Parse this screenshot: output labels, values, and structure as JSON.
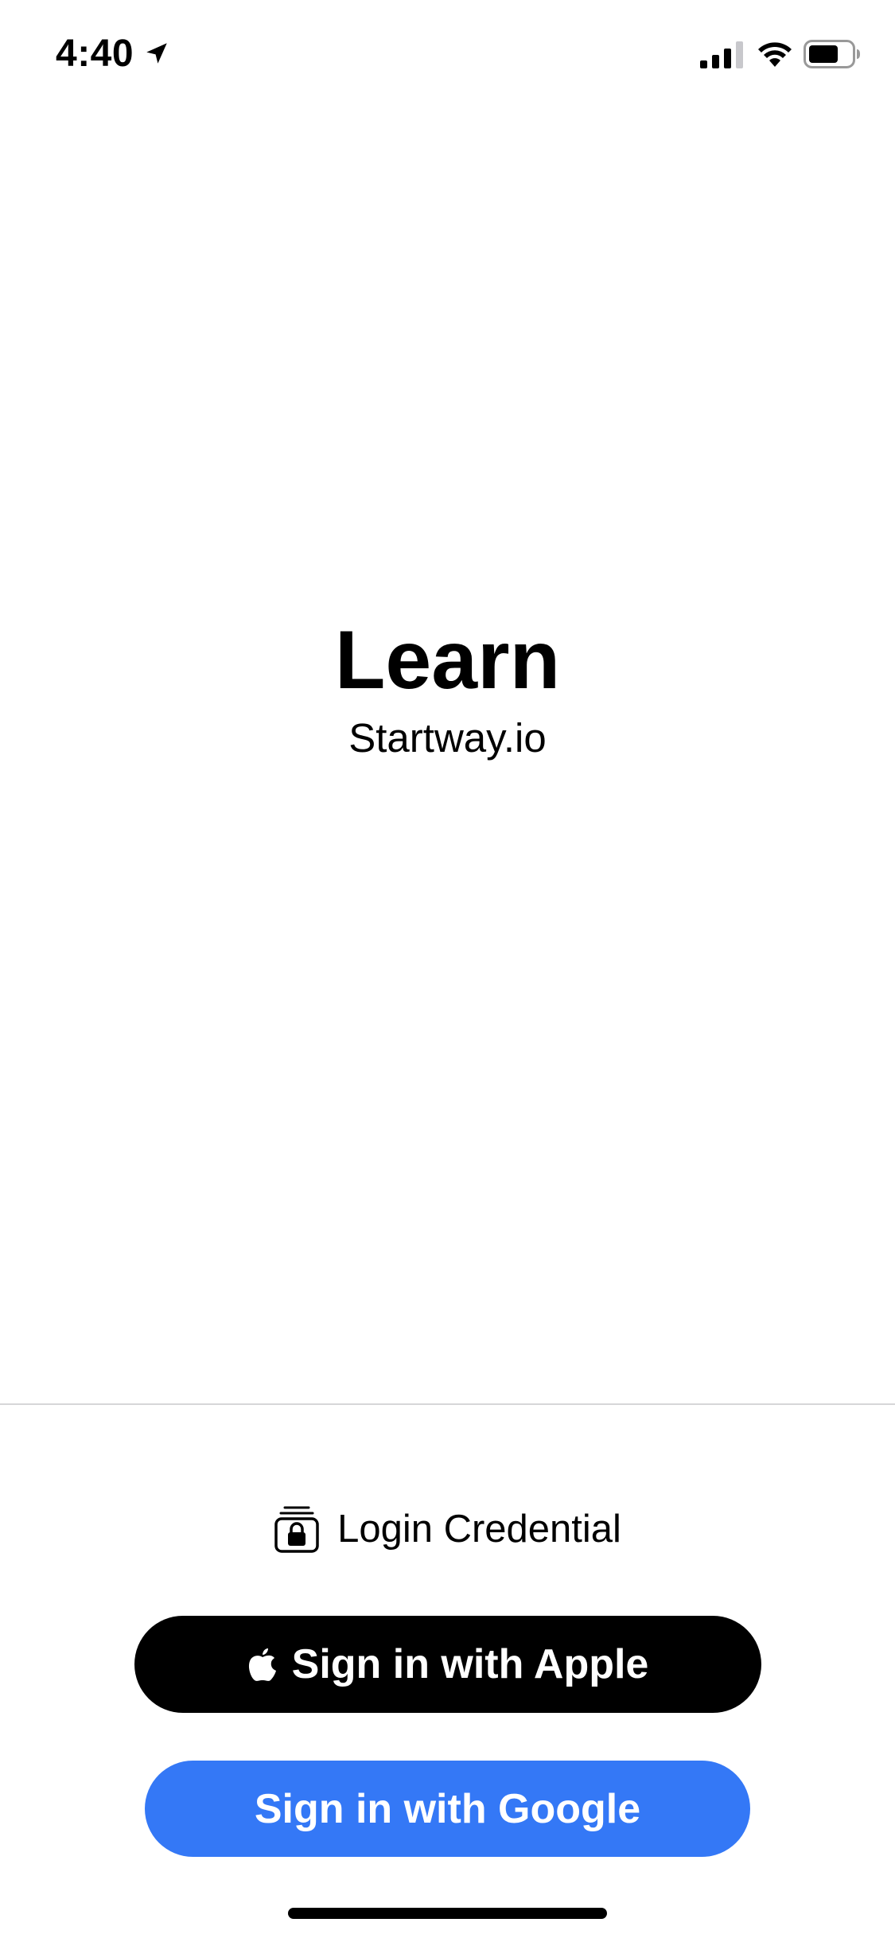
{
  "status_bar": {
    "time": "4:40",
    "icons": {
      "location": "location-arrow-icon",
      "signal": "cellular-signal-icon",
      "wifi": "wifi-icon",
      "battery": "battery-icon"
    }
  },
  "main": {
    "title": "Learn",
    "subtitle": "Startway.io"
  },
  "auth": {
    "credential_label": "Login Credential",
    "credential_icon": "lock-credential-icon",
    "apple_label": "Sign in with Apple",
    "apple_icon": "apple-logo-icon",
    "google_label": "Sign in with Google"
  },
  "colors": {
    "background": "#ffffff",
    "apple_button": "#000000",
    "google_button": "#3478f6",
    "divider": "#d6d6d8"
  }
}
